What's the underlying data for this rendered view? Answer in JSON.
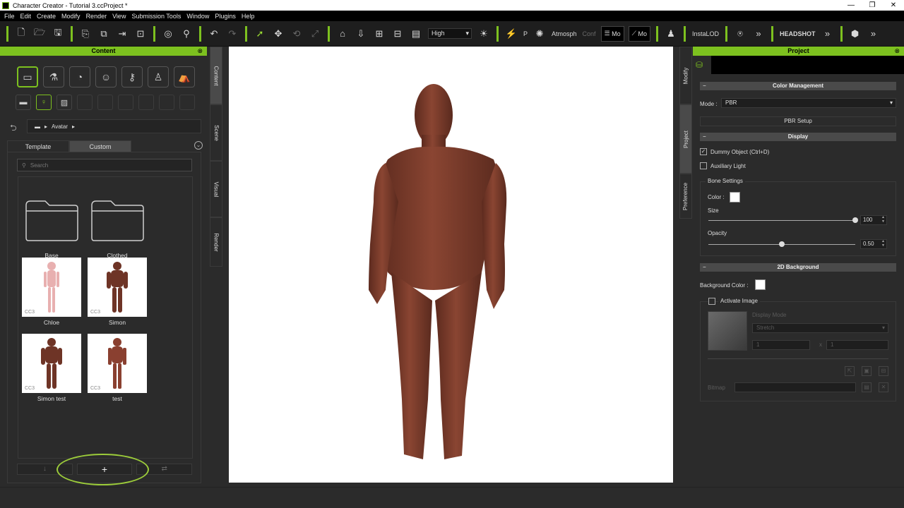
{
  "window": {
    "title": "Character Creator - Tutorial 3.ccProject *",
    "controls": [
      "—",
      "❐",
      "✕"
    ]
  },
  "menu": [
    "File",
    "Edit",
    "Create",
    "Modify",
    "Render",
    "View",
    "Submission Tools",
    "Window",
    "Plugins",
    "Help"
  ],
  "toolbar": {
    "quality": "High",
    "labels": {
      "pose": "P",
      "atmosphere": "Atmosph",
      "conform": "Conf",
      "mode1": "Mo",
      "mode2": "Mo",
      "instalod": "InstaLOD",
      "headshot": "HEADSHOT"
    }
  },
  "content_panel": {
    "title": "Content",
    "close": "⊗",
    "breadcrumb": "Avatar",
    "tabs": [
      "Template",
      "Custom"
    ],
    "selected_tab": "Custom",
    "search_placeholder": "Search",
    "items": [
      {
        "label": "Base",
        "kind": "folder"
      },
      {
        "label": "Clothed",
        "kind": "folder"
      },
      {
        "label": "Chloe",
        "kind": "avatar",
        "badge": "CC3",
        "skin": "#e8b0b0"
      },
      {
        "label": "Simon",
        "kind": "avatar",
        "badge": "CC3",
        "skin": "#7a3a2a"
      },
      {
        "label": "Simon test",
        "kind": "avatar",
        "badge": "CC3",
        "skin": "#7a3a2a"
      },
      {
        "label": "test",
        "kind": "avatar",
        "badge": "CC3",
        "skin": "#8a4030"
      }
    ],
    "add_button": "+"
  },
  "left_vtabs": [
    "Content",
    "Scene",
    "Visual",
    "Render"
  ],
  "right_vtabs": [
    "Modify",
    "Project",
    "Preference"
  ],
  "project_panel": {
    "title": "Project",
    "close": "⊗",
    "color_management": "Color Management",
    "mode_label": "Mode :",
    "mode_value": "PBR",
    "pbr_setup": "PBR Setup",
    "display": "Display",
    "dummy_object": "Dummy Object (Ctrl+D)",
    "auxiliary_light": "Auxiliary Light",
    "bone_settings": "Bone Settings",
    "color_label": "Color :",
    "size_label": "Size",
    "size_value": "100",
    "size_fraction": 1.0,
    "opacity_label": "Opacity",
    "opacity_value": "0.50",
    "opacity_fraction": 0.5,
    "bg_section": "2D Background",
    "bg_color_label": "Background Color :",
    "activate_image": "Activate Image",
    "display_mode": "Display Mode",
    "display_mode_value": "Stretch",
    "tile_x": "1",
    "tile_x_sep": "x",
    "tile_y": "1",
    "bitmap": "Bitmap"
  },
  "colors": {
    "accent": "#7dc11f",
    "panel": "#2b2b2b",
    "viewport": "#ffffff"
  }
}
